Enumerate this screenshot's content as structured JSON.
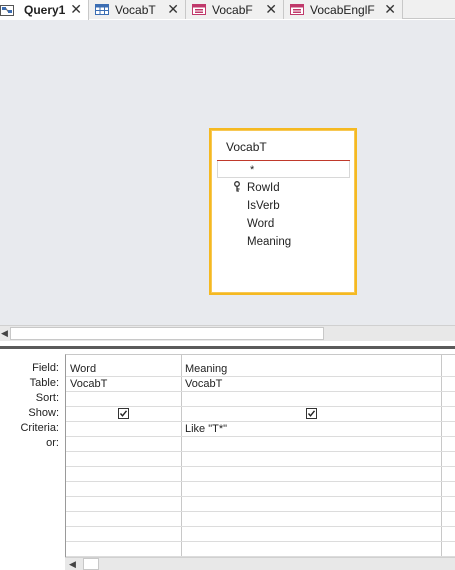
{
  "tabs": [
    {
      "label": "Query1",
      "icon": "query-icon",
      "active": true
    },
    {
      "label": "VocabT",
      "icon": "table-icon",
      "active": false
    },
    {
      "label": "VocabF",
      "icon": "form-icon",
      "active": false
    },
    {
      "label": "VocabEnglF",
      "icon": "form-icon",
      "active": false
    }
  ],
  "close_glyph": "✕",
  "field_list": {
    "title": "VocabT",
    "star": "*",
    "fields": [
      "RowId",
      "IsVerb",
      "Word",
      "Meaning"
    ],
    "key_field": "RowId"
  },
  "qbe": {
    "row_labels": {
      "field": "Field:",
      "table": "Table:",
      "sort": "Sort:",
      "show": "Show:",
      "criteria": "Criteria:",
      "or": "or:"
    },
    "columns": [
      {
        "field": "Word",
        "table": "VocabT",
        "sort": "",
        "show": true,
        "criteria": ""
      },
      {
        "field": "Meaning",
        "table": "VocabT",
        "sort": "",
        "show": true,
        "criteria": "Like \"T*\""
      }
    ]
  },
  "colors": {
    "field_list_border": "#f5b921",
    "title_separator": "#c0392b",
    "design_background": "#e8eaee",
    "form_icon_accent": "#c0396b",
    "table_icon_accent": "#3b6db3"
  }
}
